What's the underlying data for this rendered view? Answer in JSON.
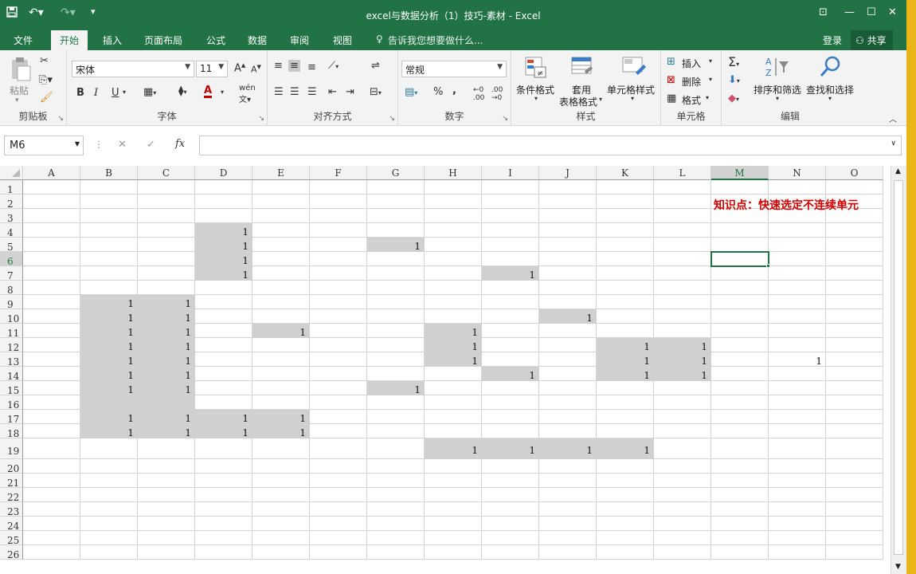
{
  "window": {
    "title": "excel与数据分析（1）技巧-素材 - Excel"
  },
  "quick_access": {
    "save_icon": "save-icon",
    "undo_icon": "undo-icon",
    "redo_icon": "redo-icon"
  },
  "menu": {
    "tabs": [
      "文件",
      "开始",
      "插入",
      "页面布局",
      "公式",
      "数据",
      "审阅",
      "视图"
    ],
    "active": "开始",
    "tell_me": "告诉我您想要做什么...",
    "login": "登录",
    "share": "共享"
  },
  "ribbon": {
    "clipboard": {
      "label": "剪贴板",
      "paste": "粘贴"
    },
    "font": {
      "label": "字体",
      "font_name": "宋体",
      "font_size": "11",
      "bold": "B",
      "italic": "I",
      "underline": "U"
    },
    "alignment": {
      "label": "对齐方式"
    },
    "number": {
      "label": "数字",
      "format": "常规"
    },
    "styles": {
      "label": "样式",
      "cond_format": "条件格式",
      "table_format_1": "套用",
      "table_format_2": "表格格式",
      "cell_styles": "单元格样式"
    },
    "cells": {
      "label": "单元格",
      "insert": "插入",
      "delete": "删除",
      "format": "格式"
    },
    "editing": {
      "label": "编辑",
      "sort_filter": "排序和筛选",
      "find_select": "查找和选择"
    }
  },
  "formula_bar": {
    "name_box": "M6",
    "formula": "",
    "fx": "fx"
  },
  "grid": {
    "columns": [
      "A",
      "B",
      "C",
      "D",
      "E",
      "F",
      "G",
      "H",
      "I",
      "J",
      "K",
      "L",
      "M",
      "N",
      "O"
    ],
    "rows": [
      1,
      2,
      3,
      4,
      5,
      6,
      7,
      8,
      9,
      10,
      11,
      12,
      13,
      14,
      15,
      16,
      17,
      18,
      19,
      20,
      21,
      22,
      23,
      24,
      25,
      26
    ],
    "selected_col": "M",
    "selected_row": 6,
    "note": "知识点：快速选定不连续单元",
    "cells": [
      {
        "r": 4,
        "c": 3,
        "v": "1",
        "fill": true
      },
      {
        "r": 5,
        "c": 3,
        "v": "1",
        "fill": true
      },
      {
        "r": 6,
        "c": 3,
        "v": "1",
        "fill": true
      },
      {
        "r": 7,
        "c": 3,
        "v": "1",
        "fill": true
      },
      {
        "r": 5,
        "c": 6,
        "v": "1",
        "fill": true
      },
      {
        "r": 7,
        "c": 8,
        "v": "1",
        "fill": true
      },
      {
        "r": 9,
        "c": 1,
        "v": "1",
        "fill": true
      },
      {
        "r": 9,
        "c": 2,
        "v": "1",
        "fill": true
      },
      {
        "r": 10,
        "c": 1,
        "v": "1",
        "fill": true
      },
      {
        "r": 10,
        "c": 2,
        "v": "1",
        "fill": true
      },
      {
        "r": 10,
        "c": 9,
        "v": "1",
        "fill": true
      },
      {
        "r": 11,
        "c": 1,
        "v": "1",
        "fill": true
      },
      {
        "r": 11,
        "c": 2,
        "v": "1",
        "fill": true
      },
      {
        "r": 11,
        "c": 4,
        "v": "1",
        "fill": true
      },
      {
        "r": 11,
        "c": 7,
        "v": "1",
        "fill": true
      },
      {
        "r": 12,
        "c": 1,
        "v": "1",
        "fill": true
      },
      {
        "r": 12,
        "c": 2,
        "v": "1",
        "fill": true
      },
      {
        "r": 12,
        "c": 7,
        "v": "1",
        "fill": true
      },
      {
        "r": 12,
        "c": 10,
        "v": "1",
        "fill": true
      },
      {
        "r": 12,
        "c": 11,
        "v": "1",
        "fill": true
      },
      {
        "r": 13,
        "c": 1,
        "v": "1",
        "fill": true
      },
      {
        "r": 13,
        "c": 2,
        "v": "1",
        "fill": true
      },
      {
        "r": 13,
        "c": 7,
        "v": "1",
        "fill": true
      },
      {
        "r": 13,
        "c": 10,
        "v": "1",
        "fill": true
      },
      {
        "r": 13,
        "c": 11,
        "v": "1",
        "fill": true
      },
      {
        "r": 13,
        "c": 13,
        "v": "1",
        "fill": false
      },
      {
        "r": 14,
        "c": 1,
        "v": "1",
        "fill": true
      },
      {
        "r": 14,
        "c": 2,
        "v": "1",
        "fill": true
      },
      {
        "r": 14,
        "c": 8,
        "v": "1",
        "fill": true
      },
      {
        "r": 14,
        "c": 10,
        "v": "1",
        "fill": true
      },
      {
        "r": 14,
        "c": 11,
        "v": "1",
        "fill": true
      },
      {
        "r": 15,
        "c": 1,
        "v": "1",
        "fill": true
      },
      {
        "r": 15,
        "c": 2,
        "v": "1",
        "fill": true
      },
      {
        "r": 15,
        "c": 6,
        "v": "1",
        "fill": true
      },
      {
        "r": 16,
        "c": 1,
        "v": "",
        "fill": true
      },
      {
        "r": 16,
        "c": 2,
        "v": "",
        "fill": true
      },
      {
        "r": 17,
        "c": 1,
        "v": "1",
        "fill": true
      },
      {
        "r": 17,
        "c": 2,
        "v": "1",
        "fill": true
      },
      {
        "r": 17,
        "c": 3,
        "v": "1",
        "fill": true
      },
      {
        "r": 17,
        "c": 4,
        "v": "1",
        "fill": true
      },
      {
        "r": 18,
        "c": 1,
        "v": "1",
        "fill": true
      },
      {
        "r": 18,
        "c": 2,
        "v": "1",
        "fill": true
      },
      {
        "r": 18,
        "c": 3,
        "v": "1",
        "fill": true
      },
      {
        "r": 18,
        "c": 4,
        "v": "1",
        "fill": true
      },
      {
        "r": 19,
        "c": 7,
        "v": "1",
        "fill": true
      },
      {
        "r": 19,
        "c": 8,
        "v": "1",
        "fill": true
      },
      {
        "r": 19,
        "c": 9,
        "v": "1",
        "fill": true
      },
      {
        "r": 19,
        "c": 10,
        "v": "1",
        "fill": true
      }
    ]
  },
  "colors": {
    "accent": "#217346",
    "cell_fill": "#d0d0d0",
    "note": "#d00000"
  }
}
